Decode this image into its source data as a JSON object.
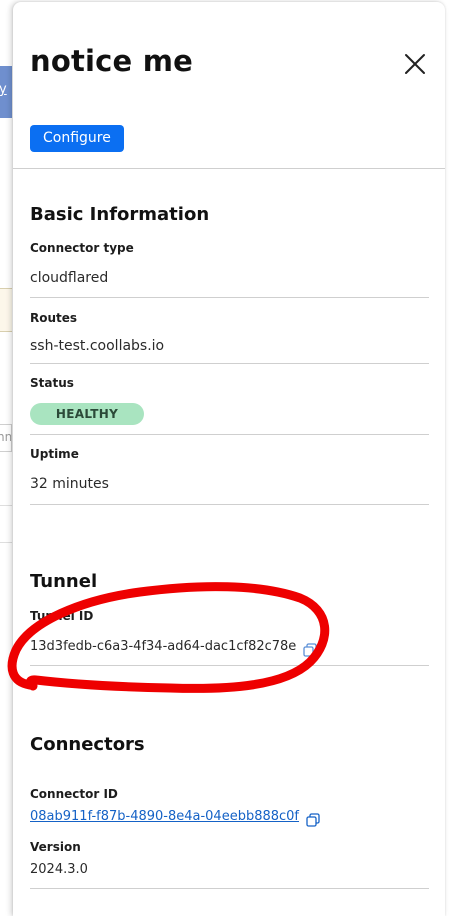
{
  "background": {
    "link_fragment": "y",
    "input_fragment": "nn"
  },
  "drawer": {
    "title": "notice me",
    "configure_label": "Configure"
  },
  "basic_info": {
    "heading": "Basic Information",
    "connector_type_label": "Connector type",
    "connector_type_value": "cloudflared",
    "routes_label": "Routes",
    "routes_value": "ssh-test.coollabs.io",
    "status_label": "Status",
    "status_value": "HEALTHY",
    "uptime_label": "Uptime",
    "uptime_value": "32 minutes"
  },
  "tunnel": {
    "heading": "Tunnel",
    "tunnel_id_label": "Tunnel ID",
    "tunnel_id_value": "13d3fedb-c6a3-4f34-ad64-dac1cf82c78e"
  },
  "connectors": {
    "heading": "Connectors",
    "connector_id_label": "Connector ID",
    "connector_id_value": "08ab911f-f87b-4890-8e4a-04eebb888c0f",
    "version_label": "Version",
    "version_value": "2024.3.0"
  },
  "colors": {
    "primary": "#0b6ff2",
    "healthy_badge": "#a9e4c0",
    "link": "#1562c6",
    "annotation": "#ee0000"
  },
  "icons": {
    "close": "close-icon",
    "copy": "copy-icon"
  }
}
